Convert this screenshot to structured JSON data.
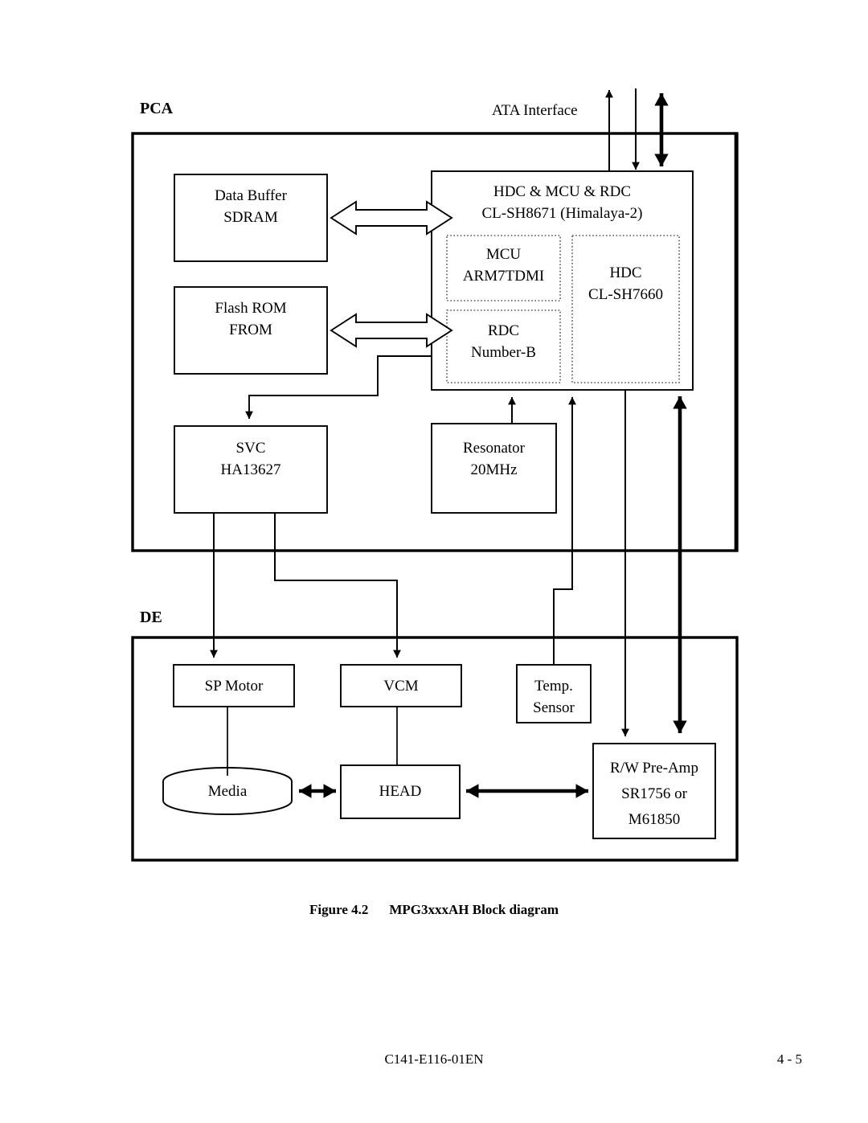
{
  "page": {
    "figure_caption": {
      "number": "Figure 4.2",
      "title": "MPG3xxxAH Block diagram"
    },
    "footer": {
      "document_id": "C141-E116-01EN",
      "page_number": "4 - 5"
    }
  },
  "diagram": {
    "sections": [
      {
        "id": "pca",
        "label": "PCA"
      },
      {
        "id": "de",
        "label": "DE"
      }
    ],
    "external_labels": [
      {
        "id": "ata-interface",
        "label": "ATA Interface"
      }
    ],
    "blocks": [
      {
        "id": "data-buffer",
        "lines": [
          "Data Buffer",
          "SDRAM"
        ]
      },
      {
        "id": "flash-rom",
        "lines": [
          "Flash ROM",
          "FROM"
        ]
      },
      {
        "id": "controller",
        "lines": [
          "HDC & MCU & RDC",
          "CL-SH8671 (Himalaya-2)"
        ]
      },
      {
        "id": "mcu",
        "lines": [
          "MCU",
          "ARM7TDMI"
        ]
      },
      {
        "id": "rdc",
        "lines": [
          "RDC",
          "Number-B"
        ]
      },
      {
        "id": "hdc",
        "lines": [
          "HDC",
          "CL-SH7660"
        ]
      },
      {
        "id": "svc",
        "lines": [
          "SVC",
          "HA13627"
        ]
      },
      {
        "id": "resonator",
        "lines": [
          "Resonator",
          "20MHz"
        ]
      },
      {
        "id": "sp-motor",
        "lines": [
          "SP Motor"
        ]
      },
      {
        "id": "vcm",
        "lines": [
          "VCM"
        ]
      },
      {
        "id": "temp-sensor",
        "lines": [
          "Temp.",
          "Sensor"
        ]
      },
      {
        "id": "media",
        "lines": [
          "Media"
        ]
      },
      {
        "id": "head",
        "lines": [
          "HEAD"
        ]
      },
      {
        "id": "rw-preamp",
        "lines": [
          "R/W Pre-Amp",
          "SR1756 or",
          "M61850"
        ]
      }
    ],
    "colors": {
      "stroke": "#000000",
      "background": "#ffffff",
      "dotted_stroke": "#555555"
    }
  }
}
